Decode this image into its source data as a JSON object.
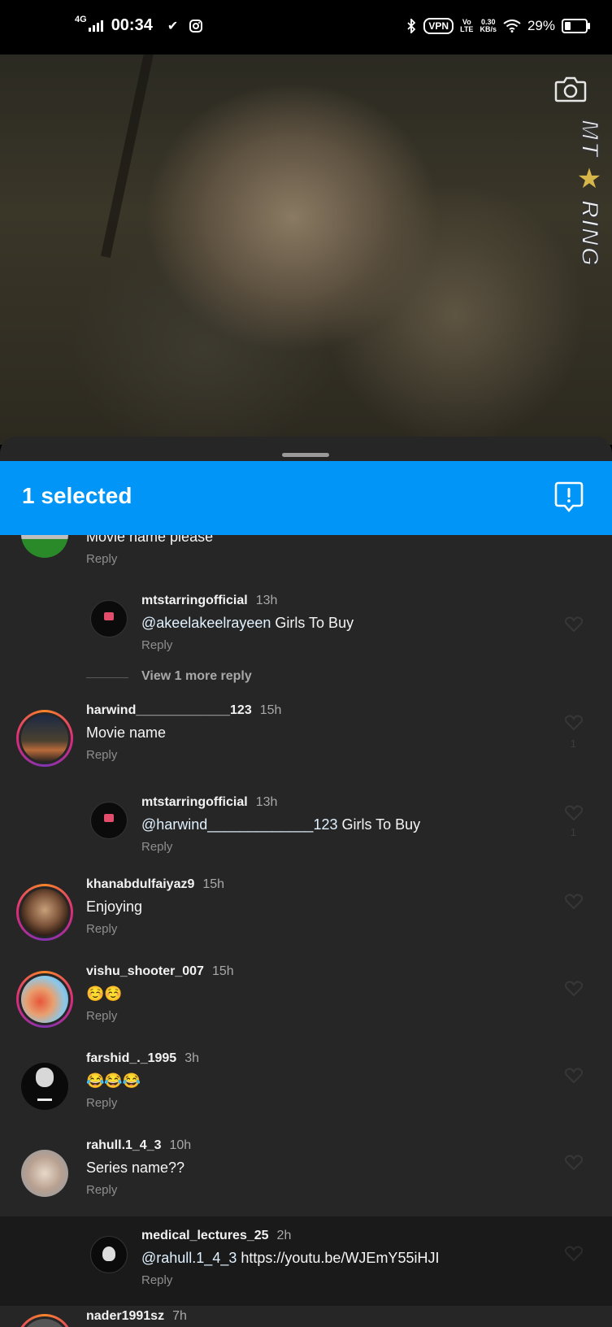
{
  "status_bar": {
    "network": "4G",
    "time": "00:34",
    "vpn": "VPN",
    "volte_top": "Vo",
    "volte_bottom": "LTE",
    "speed_top": "0.30",
    "speed_bottom": "KB/s",
    "battery": "29%",
    "battery_level": 0.29
  },
  "video": {
    "watermark_top": "MT",
    "watermark_bottom": "RING",
    "camera_icon": "camera-icon"
  },
  "selection": {
    "title": "1 selected",
    "report_icon": "report-icon",
    "bar_color": "#0095f6"
  },
  "comments": {
    "top": {
      "text": "Movie name please",
      "reply": "Reply"
    },
    "reply1": {
      "username": "mtstarringofficial",
      "time": "13h",
      "mention": "@akeelakeelrayeen",
      "text": " Girls To Buy",
      "reply": "Reply"
    },
    "view_more": "View 1 more reply",
    "c2": {
      "username": "harwind_____________123",
      "time": "15h",
      "text": "Movie name",
      "reply": "Reply",
      "likes": "1"
    },
    "reply2": {
      "username": "mtstarringofficial",
      "time": "13h",
      "mention": "@harwind_____________123",
      "text": " Girls To Buy",
      "reply": "Reply",
      "likes": "1"
    },
    "c3": {
      "username": "khanabdulfaiyaz9",
      "time": "15h",
      "text": "Enjoying",
      "reply": "Reply"
    },
    "c4": {
      "username": "vishu_shooter_007",
      "time": "15h",
      "text": "☺️☺️",
      "reply": "Reply"
    },
    "c5": {
      "username": "farshid_._1995",
      "time": "3h",
      "text": "😂😂😂",
      "reply": "Reply"
    },
    "c6": {
      "username": "rahull.1_4_3",
      "time": "10h",
      "text": "Series name??",
      "reply": "Reply"
    },
    "reply3": {
      "username": "medical_lectures_25",
      "time": "2h",
      "mention": "@rahull.1_4_3",
      "text": " https://youtu.be/WJEmY55iHJI",
      "reply": "Reply"
    },
    "c7": {
      "username": "nader1991sz",
      "time": "7h"
    }
  }
}
